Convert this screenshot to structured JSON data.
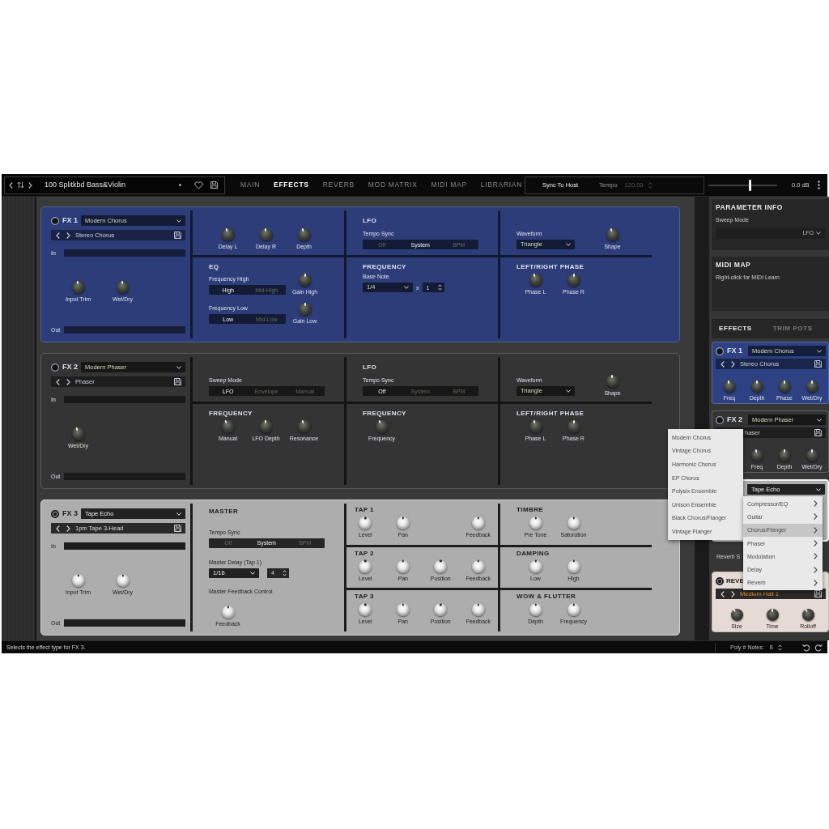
{
  "top_bar": {
    "preset_name": "100 Splitkbd Bass&Violin",
    "tabs": [
      {
        "label": "MAIN",
        "selected": false
      },
      {
        "label": "EFFECTS",
        "selected": true
      },
      {
        "label": "REVERB",
        "selected": false
      },
      {
        "label": "MOD MATRIX",
        "selected": false
      },
      {
        "label": "MIDI MAP",
        "selected": false
      },
      {
        "label": "LIBRARIAN",
        "selected": false
      }
    ],
    "sync_button": "Sync To Host",
    "tempo": {
      "label": "Tempo",
      "value": "120.00",
      "disabled": true
    },
    "volume": {
      "level": 0.6
    },
    "volume_reading": "0.0 dB"
  },
  "fx_panels": [
    {
      "slot": "FX 1",
      "color": "#2d3d79",
      "type": "Modern Chorus",
      "preset": "Stereo Chorus",
      "in_label": "In",
      "out_label": "Out",
      "knobs": [
        {
          "label": "Input Trim",
          "level": 0.45
        },
        {
          "label": "Wet/Dry",
          "level": 0.45
        }
      ],
      "columns": [
        [
          {
            "kind": "stack",
            "rows": [
              [
                {
                  "kind": "knob",
                  "label": "Delay L",
                  "level": 0.4
                },
                {
                  "kind": "knob",
                  "label": "Delay R",
                  "level": 0.45
                },
                {
                  "kind": "knob",
                  "label": "Depth",
                  "level": 0.4
                }
              ]
            ]
          },
          {
            "kind": "stack",
            "title": "EQ",
            "rows": [
              [
                {
                  "kind": "switch",
                  "label": "Frequency High",
                  "options": [
                    {
                      "label": "High",
                      "selected": true
                    },
                    {
                      "label": "Mid-High",
                      "selected": false
                    }
                  ]
                },
                {
                  "kind": "knob",
                  "label": "Gain High",
                  "level": 0.5
                }
              ],
              [
                {
                  "kind": "switch",
                  "label": "Frequency Low",
                  "options": [
                    {
                      "label": "Low",
                      "selected": true
                    },
                    {
                      "label": "Mid-Low",
                      "selected": false
                    }
                  ]
                },
                {
                  "kind": "knob",
                  "label": "Gain Low",
                  "level": 0.5
                }
              ]
            ]
          }
        ],
        [
          {
            "kind": "stack",
            "title": "LFO",
            "rows": [
              [
                {
                  "kind": "switch",
                  "label": "Tempo Sync",
                  "options": [
                    {
                      "label": "Off",
                      "selected": false
                    },
                    {
                      "label": "System",
                      "selected": true
                    },
                    {
                      "label": "BPM",
                      "selected": false
                    }
                  ]
                }
              ]
            ]
          },
          {
            "kind": "stack",
            "title": "FREQUENCY",
            "rows": [
              [
                {
                  "kind": "note",
                  "label": "Base Note",
                  "value": "1/4",
                  "sign": "x",
                  "multiplier": "1"
                }
              ]
            ]
          }
        ],
        [
          {
            "kind": "stack",
            "rows": [
              [
                {
                  "kind": "select",
                  "label": "Waveform",
                  "value": "Triangle"
                },
                {
                  "kind": "knob",
                  "label": "Shape",
                  "level": 0.4
                }
              ]
            ]
          },
          {
            "kind": "stack",
            "title": "LEFT/RIGHT PHASE",
            "rows": [
              [
                {
                  "kind": "knob",
                  "label": "Phase L",
                  "level": 0.4
                },
                {
                  "kind": "knob",
                  "label": "Phase R",
                  "level": 0.5
                }
              ]
            ]
          }
        ]
      ]
    },
    {
      "slot": "FX 2",
      "color": "#343434",
      "type": "Modern Phaser",
      "preset": "Phaser",
      "in_label": "In",
      "out_label": "Out",
      "knobs": [
        {
          "label": "Wet/Dry",
          "level": 0.4
        }
      ],
      "columns": [
        [
          {
            "kind": "stack",
            "rows": [
              [
                {
                  "kind": "switch",
                  "label": "Sweep Mode",
                  "options": [
                    {
                      "label": "LFO",
                      "selected": true
                    },
                    {
                      "label": "Envelope",
                      "selected": false
                    },
                    {
                      "label": "Manual",
                      "selected": false
                    }
                  ]
                }
              ]
            ]
          },
          {
            "kind": "stack",
            "title": "FREQUENCY",
            "rows": [
              [
                {
                  "kind": "knob",
                  "label": "Manual",
                  "level": 0.35
                },
                {
                  "kind": "knob",
                  "label": "LFO Depth",
                  "level": 0.45
                },
                {
                  "kind": "knob",
                  "label": "Resonance",
                  "level": 0.4
                }
              ]
            ]
          }
        ],
        [
          {
            "kind": "stack",
            "title": "LFO",
            "rows": [
              [
                {
                  "kind": "switch",
                  "label": "Tempo Sync",
                  "options": [
                    {
                      "label": "Off",
                      "selected": true
                    },
                    {
                      "label": "System",
                      "selected": false
                    },
                    {
                      "label": "BPM",
                      "selected": false
                    }
                  ]
                }
              ]
            ]
          },
          {
            "kind": "stack",
            "title": "FREQUENCY",
            "rows": [
              [
                {
                  "kind": "knob",
                  "label": "Frequency",
                  "level": 0.35
                }
              ]
            ]
          }
        ],
        [
          {
            "kind": "stack",
            "rows": [
              [
                {
                  "kind": "select",
                  "label": "Waveform",
                  "value": "Triangle"
                },
                {
                  "kind": "knob",
                  "label": "Shape",
                  "level": 0.45
                }
              ]
            ]
          },
          {
            "kind": "stack",
            "title": "LEFT/RIGHT PHASE",
            "rows": [
              [
                {
                  "kind": "knob",
                  "label": "Phase L",
                  "level": 0.4
                },
                {
                  "kind": "knob",
                  "label": "Phase R",
                  "level": 0.5
                }
              ]
            ]
          }
        ]
      ]
    },
    {
      "slot": "FX 3",
      "color": "#adadad",
      "type": "Tape Echo",
      "preset": "1pm Tape 3-Head",
      "in_label": "In",
      "out_label": "Out",
      "knobs": [
        {
          "label": "Input Trim",
          "level": 0.5
        },
        {
          "label": "Wet/Dry",
          "level": 0.5
        }
      ],
      "columns": [
        [
          {
            "kind": "stack",
            "title": "MASTER",
            "rows": [
              [
                {
                  "kind": "switch",
                  "label": "Tempo Sync",
                  "options": [
                    {
                      "label": "Off",
                      "selected": false
                    },
                    {
                      "label": "System",
                      "selected": true
                    },
                    {
                      "label": "BPM",
                      "selected": false
                    }
                  ]
                }
              ],
              [
                {
                  "kind": "note",
                  "label": "Master Delay (Tap 1)",
                  "value": "1/16",
                  "multiplier": "4"
                }
              ],
              [
                {
                  "kind": "label",
                  "text": "Master Feedback Control"
                }
              ],
              [
                {
                  "kind": "knob",
                  "label": "Feedback",
                  "level": 0.5
                }
              ]
            ]
          }
        ],
        [
          {
            "kind": "grid",
            "title": "TAP 1",
            "rows": [
              [
                {
                  "kind": "knob",
                  "label": "Level",
                  "level": 0.5
                },
                {
                  "kind": "knob",
                  "label": "Pan",
                  "level": 0.5
                },
                {
                  "kind": "knob",
                  "label": "Feedback",
                  "level": 0.5
                }
              ]
            ]
          },
          {
            "kind": "grid",
            "title": "TAP 2",
            "rows": [
              [
                {
                  "kind": "knob",
                  "label": "Level",
                  "level": 0.5
                },
                {
                  "kind": "knob",
                  "label": "Pan",
                  "level": 0.5
                },
                {
                  "kind": "knob",
                  "label": "Position",
                  "level": 0.5
                },
                {
                  "kind": "knob",
                  "label": "Feedback",
                  "level": 0.5
                }
              ]
            ]
          },
          {
            "kind": "grid",
            "title": "TAP 3",
            "rows": [
              [
                {
                  "kind": "knob",
                  "label": "Level",
                  "level": 0.5
                },
                {
                  "kind": "knob",
                  "label": "Pan",
                  "level": 0.5
                },
                {
                  "kind": "knob",
                  "label": "Position",
                  "level": 0.5
                },
                {
                  "kind": "knob",
                  "label": "Feedback",
                  "level": 0.5
                }
              ]
            ]
          }
        ],
        [
          {
            "kind": "stack",
            "title": "TIMBRE",
            "rows": [
              [
                {
                  "kind": "knob",
                  "label": "Pre Tone",
                  "level": 0.5
                },
                {
                  "kind": "knob",
                  "label": "Saturation",
                  "level": 0.5
                }
              ]
            ]
          },
          {
            "kind": "stack",
            "title": "DAMPING",
            "rows": [
              [
                {
                  "kind": "knob",
                  "label": "Low",
                  "level": 0.5
                },
                {
                  "kind": "knob",
                  "label": "High",
                  "level": 0.5
                }
              ]
            ]
          },
          {
            "kind": "stack",
            "title": "WOW & FLUTTER",
            "rows": [
              [
                {
                  "kind": "knob",
                  "label": "Depth",
                  "level": 0.5
                },
                {
                  "kind": "knob",
                  "label": "Frequency",
                  "level": 0.5
                }
              ]
            ]
          }
        ]
      ]
    }
  ],
  "sidebar": {
    "parameter_info": {
      "title": "PARAMETER INFO",
      "parameter": "Sweep Mode",
      "value": "LFO"
    },
    "midi_map": {
      "title": "MIDI MAP",
      "hint": "Right-click for MIDI Learn"
    },
    "tabs": [
      {
        "label": "EFFECTS",
        "selected": true
      },
      {
        "label": "TRIM POTS",
        "selected": false
      }
    ],
    "cards": [
      {
        "slot": "FX 1",
        "color": "#2e4182",
        "focused": false,
        "type": "Modern Chorus",
        "preset": "Stereo Chorus",
        "preset_nav": true,
        "knobs": [
          {
            "label": "Freq",
            "level": 0.45
          },
          {
            "label": "Depth",
            "level": 0.5
          },
          {
            "label": "Phase",
            "level": 0.5
          },
          {
            "label": "Wet/Dry",
            "level": 0.5
          }
        ]
      },
      {
        "slot": "FX 2",
        "color": "#343434",
        "focused": false,
        "type": "Modern Phaser",
        "preset": "haser",
        "preset_nav": false,
        "knobs": [
          {
            "label": "Freq",
            "level": 0.4
          },
          {
            "label": "Depth",
            "level": 0.5
          },
          {
            "label": "Wet/Dry",
            "level": 0.5
          }
        ]
      },
      {
        "color": "#adadad",
        "focused": true,
        "type": "Tape Echo"
      }
    ],
    "send_label": "Reverb S",
    "reverb": {
      "slot": "REVE",
      "color": "#e6dad4",
      "preset": "Medium Hall 1",
      "preset_nav": true,
      "knobs": [
        {
          "label": "Size",
          "level": 0.3
        },
        {
          "label": "Time",
          "level": 0.5
        },
        {
          "label": "Rolloff",
          "level": 0.35
        }
      ]
    }
  },
  "effect_menu": {
    "items": [
      {
        "label": "Modern Chorus",
        "selected": false
      },
      {
        "label": "Vintage Chorus",
        "selected": false
      },
      {
        "label": "Harmonic Chorus",
        "selected": false
      },
      {
        "label": "EP Chorus",
        "selected": false
      },
      {
        "label": "Polysix Ensemble",
        "selected": false
      },
      {
        "label": "Unison Ensemble",
        "selected": false
      },
      {
        "label": "Black Chorus/Flanger",
        "selected": false
      },
      {
        "label": "Vintage Flanger",
        "selected": false
      }
    ]
  },
  "category_menu": {
    "items": [
      {
        "label": "Compressor/EQ",
        "selected": false
      },
      {
        "label": "Guitar",
        "selected": false
      },
      {
        "label": "Chorus/Flanger",
        "selected": true
      },
      {
        "label": "Phaser",
        "selected": false
      },
      {
        "label": "Modulation",
        "selected": false
      },
      {
        "label": "Delay",
        "selected": false
      },
      {
        "label": "Reverb",
        "selected": false
      }
    ]
  },
  "status_bar": {
    "message": "Selects the effect type for FX 3.",
    "voices_label": "Poly # Notes:",
    "voices_value": "8"
  }
}
